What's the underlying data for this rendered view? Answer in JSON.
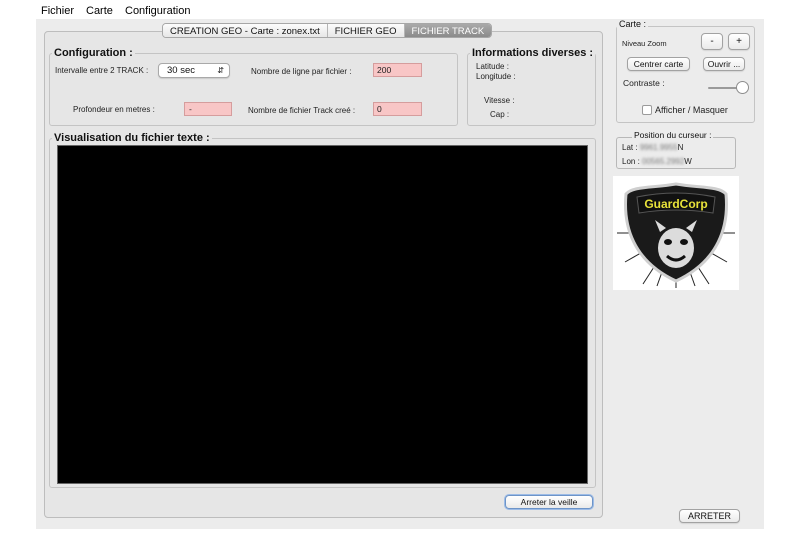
{
  "menu": {
    "items": [
      "Fichier",
      "Carte",
      "Configuration"
    ]
  },
  "tabs": [
    {
      "label": "CREATION GEO - Carte : zonex.txt",
      "active": false
    },
    {
      "label": "FICHIER GEO",
      "active": false
    },
    {
      "label": "FICHIER TRACK",
      "active": true
    }
  ],
  "configuration": {
    "legend": "Configuration :",
    "interval_label": "Intervalle entre 2 TRACK :",
    "interval_value": "30 sec",
    "lines_label": "Nombre de ligne par fichier :",
    "lines_value": "200",
    "depth_label": "Profondeur en metres :",
    "depth_value": "-",
    "track_count_label": "Nombre de fichier Track creé :",
    "track_count_value": "0"
  },
  "infos": {
    "legend": "Informations diverses :",
    "latitude_label": "Latitude :",
    "longitude_label": "Longitude :",
    "speed_label": "Vitesse :",
    "heading_label": "Cap :"
  },
  "viewer": {
    "legend": "Visualisation du fichier texte :",
    "stop_watch_button": "Arreter la veille"
  },
  "carte": {
    "legend": "Carte :",
    "zoom_label": "Niveau Zoom",
    "zoom_minus": "-",
    "zoom_plus": "+",
    "center_button": "Centrer carte",
    "open_button": "Ouvrir ...",
    "contrast_label": "Contraste :",
    "contrast_level": 1.0,
    "toggle_label": "Afficher / Masquer"
  },
  "cursor": {
    "legend": "Position du curseur :",
    "lat_label": "Lat :",
    "lat_value": "9961.9955",
    "lat_suffix": "N",
    "lon_label": "Lon :",
    "lon_value": "00565.2992",
    "lon_suffix": "W"
  },
  "logo": {
    "text": "GuardCorp",
    "accent": "#e8e23a"
  },
  "footer": {
    "stop_button": "ARRETER"
  },
  "colors": {
    "warning_field": "#f8c6c6",
    "window_bg": "#ececec",
    "viewer_bg": "#000000"
  }
}
